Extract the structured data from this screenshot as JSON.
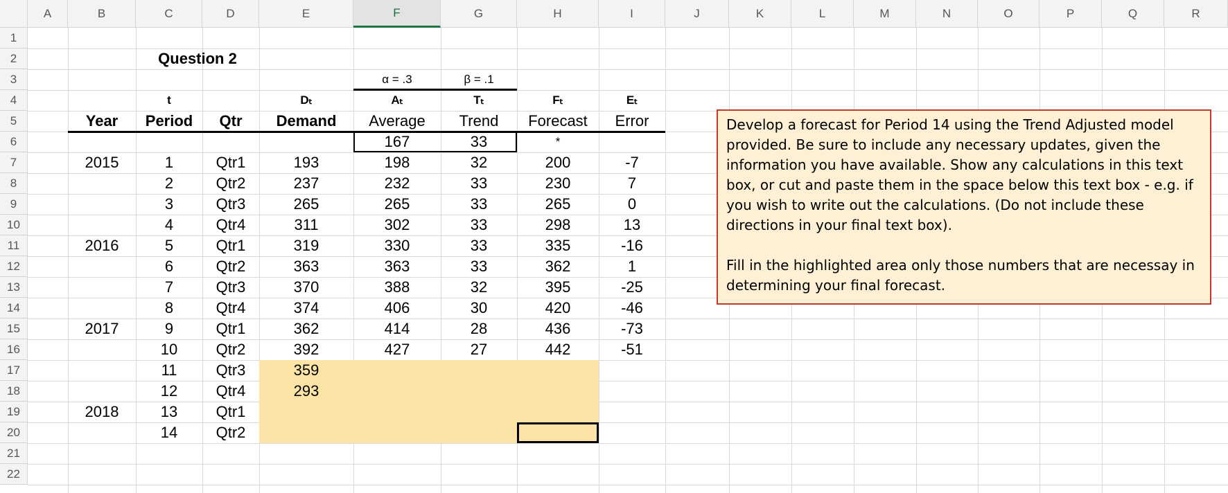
{
  "columns": [
    "A",
    "B",
    "C",
    "D",
    "E",
    "F",
    "G",
    "H",
    "I",
    "J",
    "K",
    "L",
    "M",
    "N",
    "O",
    "P",
    "Q",
    "R"
  ],
  "rows": [
    "1",
    "2",
    "3",
    "4",
    "5",
    "6",
    "7",
    "8",
    "9",
    "10",
    "11",
    "12",
    "13",
    "14",
    "15",
    "16",
    "17",
    "18",
    "19",
    "20",
    "21",
    "22"
  ],
  "selected_column": "F",
  "title": "Question 2",
  "params": {
    "alpha": "α = .3",
    "beta": "β = .1"
  },
  "symbols": {
    "t": "t",
    "Dt": "Dₜ",
    "At": "Aₜ",
    "Tt": "Tₜ",
    "Ft": "Fₜ",
    "Et": "Eₜ"
  },
  "headers": {
    "year": "Year",
    "period": "Period",
    "qtr": "Qtr",
    "demand": "Demand",
    "average": "Average",
    "trend": "Trend",
    "forecast": "Forecast",
    "error": "Error"
  },
  "initial": {
    "average": "167",
    "trend": "33",
    "forecast": "*"
  },
  "data_rows": [
    {
      "year": "2015",
      "period": "1",
      "qtr": "Qtr1",
      "demand": "193",
      "average": "198",
      "trend": "32",
      "forecast": "200",
      "error": "-7"
    },
    {
      "year": "",
      "period": "2",
      "qtr": "Qtr2",
      "demand": "237",
      "average": "232",
      "trend": "33",
      "forecast": "230",
      "error": "7"
    },
    {
      "year": "",
      "period": "3",
      "qtr": "Qtr3",
      "demand": "265",
      "average": "265",
      "trend": "33",
      "forecast": "265",
      "error": "0"
    },
    {
      "year": "",
      "period": "4",
      "qtr": "Qtr4",
      "demand": "311",
      "average": "302",
      "trend": "33",
      "forecast": "298",
      "error": "13"
    },
    {
      "year": "2016",
      "period": "5",
      "qtr": "Qtr1",
      "demand": "319",
      "average": "330",
      "trend": "33",
      "forecast": "335",
      "error": "-16"
    },
    {
      "year": "",
      "period": "6",
      "qtr": "Qtr2",
      "demand": "363",
      "average": "363",
      "trend": "33",
      "forecast": "362",
      "error": "1"
    },
    {
      "year": "",
      "period": "7",
      "qtr": "Qtr3",
      "demand": "370",
      "average": "388",
      "trend": "32",
      "forecast": "395",
      "error": "-25"
    },
    {
      "year": "",
      "period": "8",
      "qtr": "Qtr4",
      "demand": "374",
      "average": "406",
      "trend": "30",
      "forecast": "420",
      "error": "-46"
    },
    {
      "year": "2017",
      "period": "9",
      "qtr": "Qtr1",
      "demand": "362",
      "average": "414",
      "trend": "28",
      "forecast": "436",
      "error": "-73"
    },
    {
      "year": "",
      "period": "10",
      "qtr": "Qtr2",
      "demand": "392",
      "average": "427",
      "trend": "27",
      "forecast": "442",
      "error": "-51"
    },
    {
      "year": "",
      "period": "11",
      "qtr": "Qtr3",
      "demand": "359",
      "average": "",
      "trend": "",
      "forecast": "",
      "error": ""
    },
    {
      "year": "",
      "period": "12",
      "qtr": "Qtr4",
      "demand": "293",
      "average": "",
      "trend": "",
      "forecast": "",
      "error": ""
    },
    {
      "year": "2018",
      "period": "13",
      "qtr": "Qtr1",
      "demand": "",
      "average": "",
      "trend": "",
      "forecast": "",
      "error": ""
    },
    {
      "year": "",
      "period": "14",
      "qtr": "Qtr2",
      "demand": "",
      "average": "",
      "trend": "",
      "forecast": "",
      "error": ""
    }
  ],
  "note": {
    "paragraph1": "Develop a forecast for Period 14 using the Trend Adjusted model provided. Be sure to include any necessary updates, given the information you have available. Show any calculations in this text box, or cut and paste them in the space below this text box - e.g. if you wish to write out the calculations.  (Do not include these directions in your final text box).",
    "paragraph2": "Fill in the highlighted area only those numbers that are necessay in determining your final forecast."
  },
  "colors": {
    "highlight": "#fce4a6",
    "note_bg": "#fdf0d4",
    "note_border": "#c0392b",
    "selected_header": "#217346"
  }
}
